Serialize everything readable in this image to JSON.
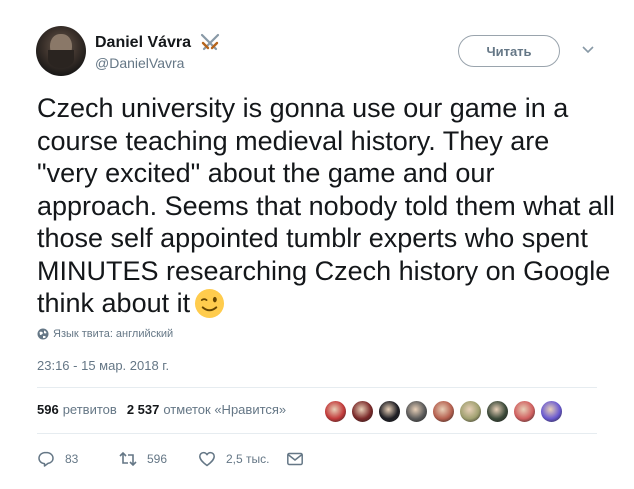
{
  "author": {
    "name": "Daniel Vávra",
    "handle": "@DanielVavra"
  },
  "follow_button": {
    "label": "Читать"
  },
  "tweet": {
    "text": "Czech university is gonna use our game in a course teaching medieval history. They are \"very excited\" about the game and our approach. Seems that nobody told them what all those self appointed tumblr experts who spent MINUTES researching Czech history on Google think about it",
    "language_note": "Язык твита: английский",
    "timestamp": "23:16 - 15 мар. 2018 г."
  },
  "stats": {
    "retweets_count": "596",
    "retweets_label": "ретвитов",
    "likes_count": "2 537",
    "likes_label": "отметок «Нравится»"
  },
  "liker_avatars": [
    "#c23b3b",
    "#7b2a2a",
    "#1e1e24",
    "#5a5a5a",
    "#b5604f",
    "#a0a070",
    "#3c4a3a",
    "#d06060",
    "#6a5ad0"
  ],
  "actions": {
    "replies": "83",
    "retweets": "596",
    "likes": "2,5 тыс."
  }
}
